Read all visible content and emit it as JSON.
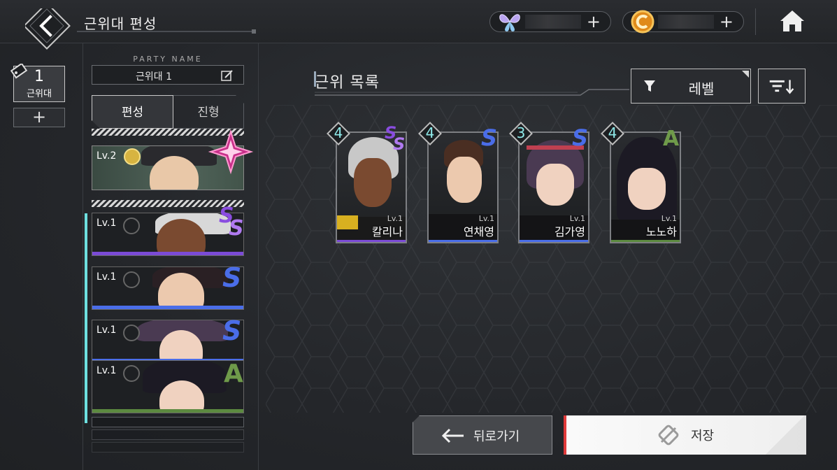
{
  "header": {
    "title": "근위대 편성",
    "currency_1_icon": "butterfly-icon",
    "currency_2_icon": "gold-coin-icon",
    "plus": "+",
    "home_icon": "home-icon"
  },
  "party": {
    "tab_number": "1",
    "tab_label": "근위대",
    "add_label": "+",
    "name_label": "PARTY NAME",
    "name_value": "근위대 1",
    "tabs": [
      "편성",
      "진형"
    ]
  },
  "leader": {
    "level": "Lv.2",
    "badge_color": "#d7b441",
    "gem_color": "#e85aa0"
  },
  "members": [
    {
      "level": "Lv.1",
      "grade": "SS",
      "grade_color": "#8a4de0",
      "line_color": "#7b4bd6"
    },
    {
      "level": "Lv.1",
      "grade": "S",
      "grade_color": "#4a6de8",
      "line_color": "#4a6de8"
    },
    {
      "level": "Lv.1",
      "grade": "S",
      "grade_color": "#4a6de8",
      "line_color": "#4a6de8"
    },
    {
      "level": "Lv.1",
      "grade": "A",
      "grade_color": "#6f9a4a",
      "line_color": "#5c8a40"
    }
  ],
  "guard_list": {
    "title": "근위 목록",
    "filter_label": "레벨",
    "filter_icon": "filter-icon",
    "sort_icon": "sort-icon"
  },
  "characters": [
    {
      "name": "칼리나",
      "level": "Lv.1",
      "tier": "4",
      "grade": "SS",
      "grade_color": "#8a4de0"
    },
    {
      "name": "연채영",
      "level": "Lv.1",
      "tier": "4",
      "grade": "S",
      "grade_color": "#4a6de8"
    },
    {
      "name": "김가영",
      "level": "Lv.1",
      "tier": "3",
      "grade": "S",
      "grade_color": "#4a6de8"
    },
    {
      "name": "노노하",
      "level": "Lv.1",
      "tier": "4",
      "grade": "A",
      "grade_color": "#6f9a4a"
    }
  ],
  "footer": {
    "back_label": "뒤로가기",
    "save_label": "저장",
    "accent": "#e03a3a"
  }
}
